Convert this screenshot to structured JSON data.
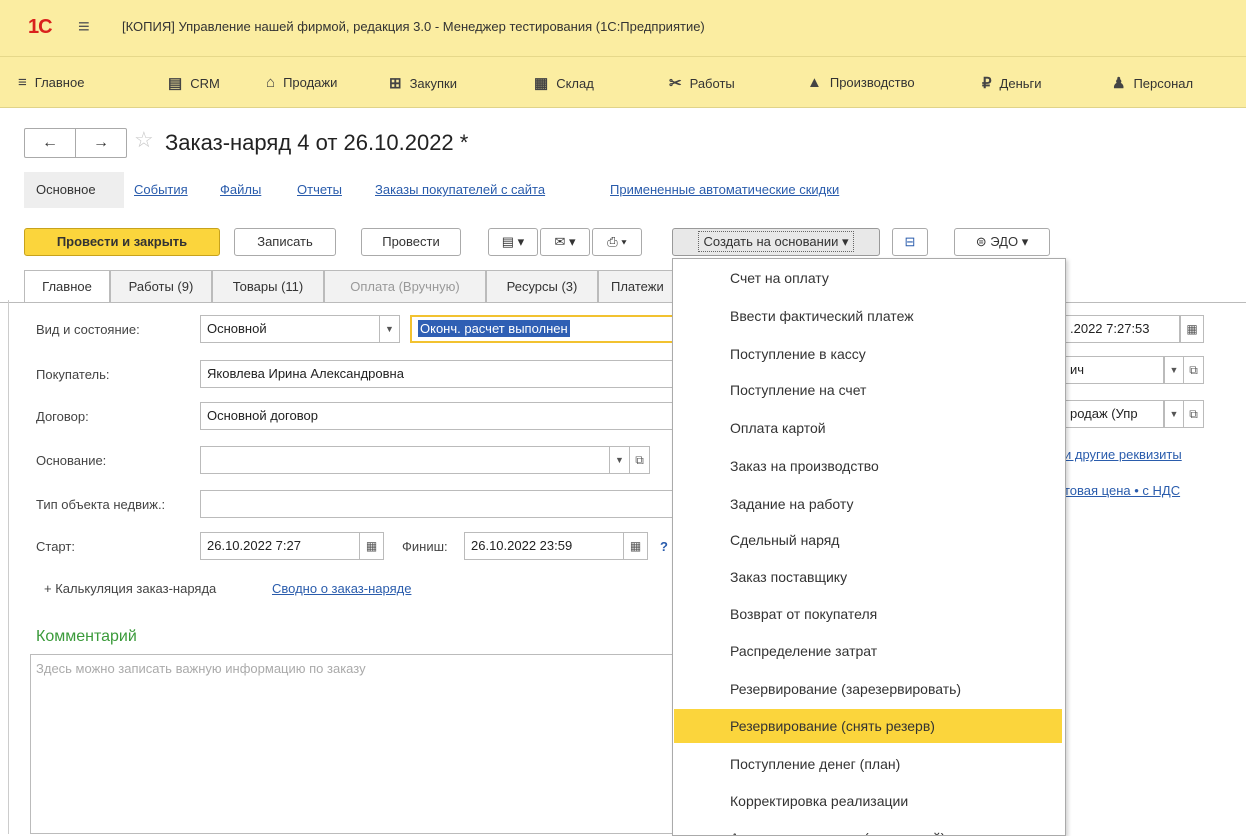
{
  "app": {
    "logo": "1С",
    "window_title": "[КОПИЯ] Управление нашей фирмой, редакция 3.0  - Менеджер тестирования (1С:Предприятие)"
  },
  "sections": [
    {
      "icon": "≡",
      "label": "Главное"
    },
    {
      "icon": "▤",
      "label": "CRM"
    },
    {
      "icon": "⌂",
      "label": "Продажи"
    },
    {
      "icon": "⊞",
      "label": "Закупки"
    },
    {
      "icon": "▦",
      "label": "Склад"
    },
    {
      "icon": "✂",
      "label": "Работы"
    },
    {
      "icon": "▲",
      "label": "Производство"
    },
    {
      "icon": "₽",
      "label": "Деньги"
    },
    {
      "icon": "♟",
      "label": "Персонал"
    }
  ],
  "header": {
    "back": "←",
    "forward": "→",
    "star": "☆",
    "title": "Заказ-наряд 4 от 26.10.2022 *"
  },
  "doc_tabs": {
    "active": "Основное",
    "links": [
      "События",
      "Файлы",
      "Отчеты",
      "Заказы покупателей с сайта",
      "Примененные автоматические скидки"
    ]
  },
  "toolbar": {
    "post_close": "Провести и закрыть",
    "save": "Записать",
    "post": "Провести",
    "create_based": "Создать на основании ▾",
    "edo": "ЭДО ▾"
  },
  "inner_tabs": [
    "Главное",
    "Работы (9)",
    "Товары (11)",
    "Оплата (Вручную)",
    "Ресурсы (3)",
    "Платежи"
  ],
  "form": {
    "kind_label": "Вид и состояние:",
    "kind_value": "Основной",
    "state_value": "Оконч. расчет выполнен",
    "buyer_label": "Покупатель:",
    "buyer_value": "Яковлева Ирина Александровна",
    "contract_label": "Договор:",
    "contract_value": "Основной договор",
    "basis_label": "Основание:",
    "basis_value": "",
    "property_label": "Тип объекта недвиж.:",
    "property_value": "",
    "start_label": "Старт:",
    "start_value": "26.10.2022  7:27",
    "finish_label": "Финиш:",
    "finish_value": "26.10.2022 23:59",
    "help": "?",
    "calc_link": "+ Калькуляция заказ-наряда",
    "summary_link": "Сводно о заказ-наряде",
    "date_right": ".2022  7:27:53",
    "right_field2": "ич",
    "right_field3": "родаж (Упр",
    "other_props_link": "и другие реквизиты",
    "price_link": "товая цена • с НДС"
  },
  "comment": {
    "title": "Комментарий",
    "placeholder": "Здесь можно записать важную информацию по заказу"
  },
  "menu": {
    "items": [
      "Счет на оплату",
      "Ввести фактический платеж",
      "Поступление в кассу",
      "Поступление на счет",
      "Оплата картой",
      "Заказ на производство",
      "Задание на работу",
      "Сдельный наряд",
      "Заказ поставщику",
      "Возврат от покупателя",
      "Распределение затрат",
      "Резервирование (зарезервировать)",
      "Резервирование (снять резерв)",
      "Поступление денег (план)",
      "Корректировка реализации",
      "Акт о расхождениях (исходящий)"
    ],
    "highlighted": "Резервирование (снять резерв)"
  },
  "colors": {
    "title_bar": "#fbeda1",
    "accent_yellow": "#fbd53c",
    "link_blue": "#2a5cac",
    "comment_green": "#3a9a3a"
  }
}
